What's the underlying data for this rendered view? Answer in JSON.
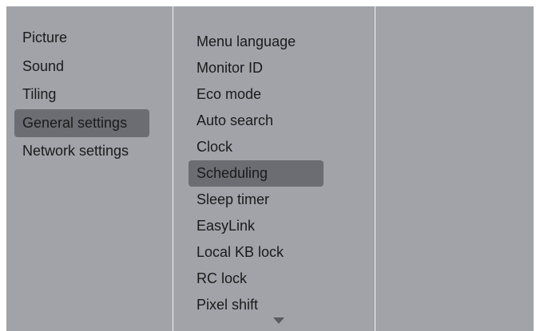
{
  "main_menu": {
    "items": [
      {
        "label": "Picture",
        "selected": false
      },
      {
        "label": "Sound",
        "selected": false
      },
      {
        "label": "Tiling",
        "selected": false
      },
      {
        "label": "General settings",
        "selected": true
      },
      {
        "label": "Network settings",
        "selected": false
      }
    ]
  },
  "sub_menu": {
    "items": [
      {
        "label": "Menu language",
        "selected": false
      },
      {
        "label": "Monitor ID",
        "selected": false
      },
      {
        "label": "Eco mode",
        "selected": false
      },
      {
        "label": "Auto search",
        "selected": false
      },
      {
        "label": "Clock",
        "selected": false
      },
      {
        "label": "Scheduling",
        "selected": true
      },
      {
        "label": "Sleep timer",
        "selected": false
      },
      {
        "label": "EasyLink",
        "selected": false
      },
      {
        "label": "Local KB lock",
        "selected": false
      },
      {
        "label": "RC lock",
        "selected": false
      },
      {
        "label": "Pixel shift",
        "selected": false
      }
    ],
    "scroll_icon": "chevron-down-triangle"
  },
  "colors": {
    "panel_bg": "#a1a3a9",
    "highlight": "#6c6d73",
    "divider": "#f2f2f2",
    "text": "#1a1a1a"
  }
}
